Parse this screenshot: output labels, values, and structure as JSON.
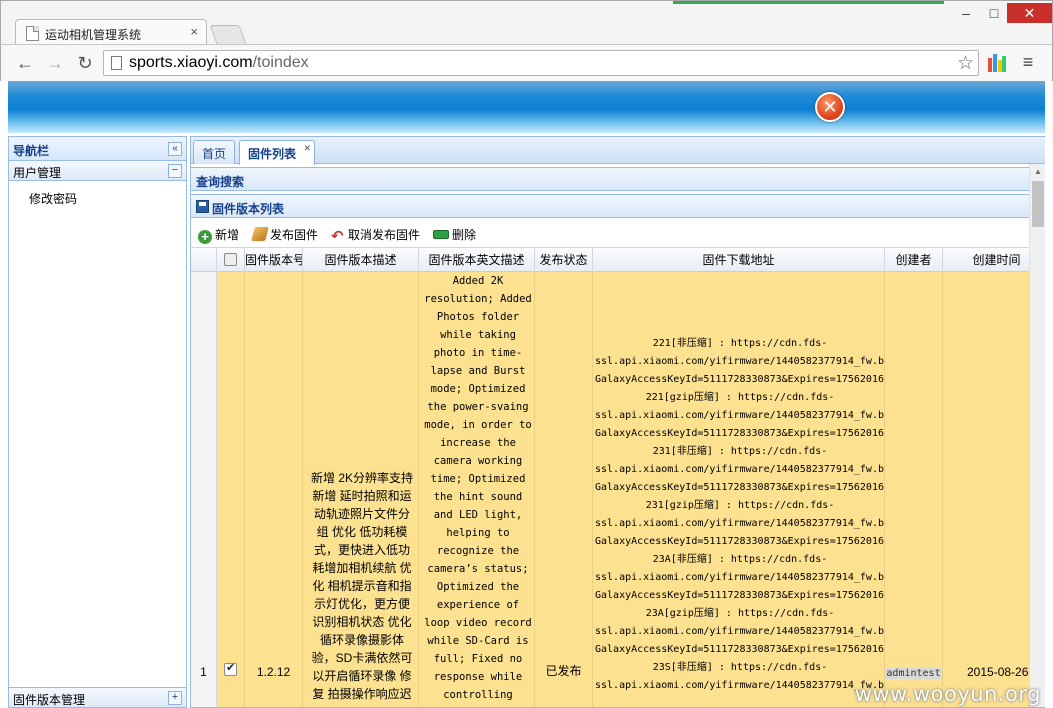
{
  "browser": {
    "tab_title": "运动相机管理系统",
    "tab_close": "×",
    "url_host": "sports.xiaoyi.com",
    "url_path": "/toindex",
    "min_glyph": "–",
    "max_glyph": "□",
    "close_glyph": "✕"
  },
  "nav": {
    "title": "导航栏",
    "collapse_glyph": "«",
    "user_mgmt": "用户管理",
    "user_mgmt_toggle": "−",
    "change_password": "修改密码",
    "firmware_mgmt": "固件版本管理",
    "firmware_mgmt_toggle": "+"
  },
  "tabs": {
    "home": "首页",
    "firmware_list": "固件列表"
  },
  "panels": {
    "search": "查询搜索",
    "list": "固件版本列表"
  },
  "actions": {
    "add": "新增",
    "publish": "发布固件",
    "unpublish": "取消发布固件",
    "delete": "删除"
  },
  "grid": {
    "columns": [
      "",
      "固件版本号",
      "固件版本描述",
      "固件版本英文描述",
      "发布状态",
      "固件下载地址",
      "创建者",
      "创建时间"
    ],
    "row": {
      "rownum": "1",
      "checked": true,
      "version": "1.2.12",
      "desc_cn": "新增 2K分辨率支持 新增 延时拍照和运动轨迹照片文件分组 优化 低功耗模式，更快进入低功耗增加相机续航 优化 相机提示音和指示灯优化，更方便识别相机状态 优化 循环录像摄影体验，SD卡满依然可以开启循环录像 修复 拍摄操作响应迟",
      "desc_en": "Added 2K resolution; Added Photos folder while taking photo in time-lapse and Burst mode; Optimized the power-svaing mode, in order to increase the camera working time; Optimized the hint sound and LED light, helping to recognize the camera’s status; Optimized the experience of loop video record while SD-Card is full; Fixed no response while controlling",
      "status": "已发布",
      "urls": [
        {
          "label": "221[非压缩] : https://cdn.fds-",
          "line2": "ssl.api.xiaomi.com/yifirmware/1440582377914_fw.b",
          "line3": "GalaxyAccessKeyId=5111728330873&Expires=17562016"
        },
        {
          "label": "221[gzip压缩] : https://cdn.fds-",
          "line2": "ssl.api.xiaomi.com/yifirmware/1440582377914_fw.b",
          "line3": "GalaxyAccessKeyId=5111728330873&Expires=17562016"
        },
        {
          "label": "231[非压缩] : https://cdn.fds-",
          "line2": "ssl.api.xiaomi.com/yifirmware/1440582377914_fw.b",
          "line3": "GalaxyAccessKeyId=5111728330873&Expires=17562016"
        },
        {
          "label": "231[gzip压缩] : https://cdn.fds-",
          "line2": "ssl.api.xiaomi.com/yifirmware/1440582377914_fw.b",
          "line3": "GalaxyAccessKeyId=5111728330873&Expires=17562016"
        },
        {
          "label": "23A[非压缩] : https://cdn.fds-",
          "line2": "ssl.api.xiaomi.com/yifirmware/1440582377914_fw.b",
          "line3": "GalaxyAccessKeyId=5111728330873&Expires=17562016"
        },
        {
          "label": "23A[gzip压缩] : https://cdn.fds-",
          "line2": "ssl.api.xiaomi.com/yifirmware/1440582377914_fw.b",
          "line3": "GalaxyAccessKeyId=5111728330873&Expires=17562016"
        },
        {
          "label": "23S[非压缩] : https://cdn.fds-",
          "line2": "ssl.api.xiaomi.com/yifirmware/1440582377914_fw.b",
          "line3": ""
        }
      ],
      "creator": "admintest",
      "created": "2015-08-26"
    }
  },
  "watermark": "www.wooyun.org",
  "colors": {
    "selected_row": "#fce191",
    "panel_title": "#15428b"
  }
}
